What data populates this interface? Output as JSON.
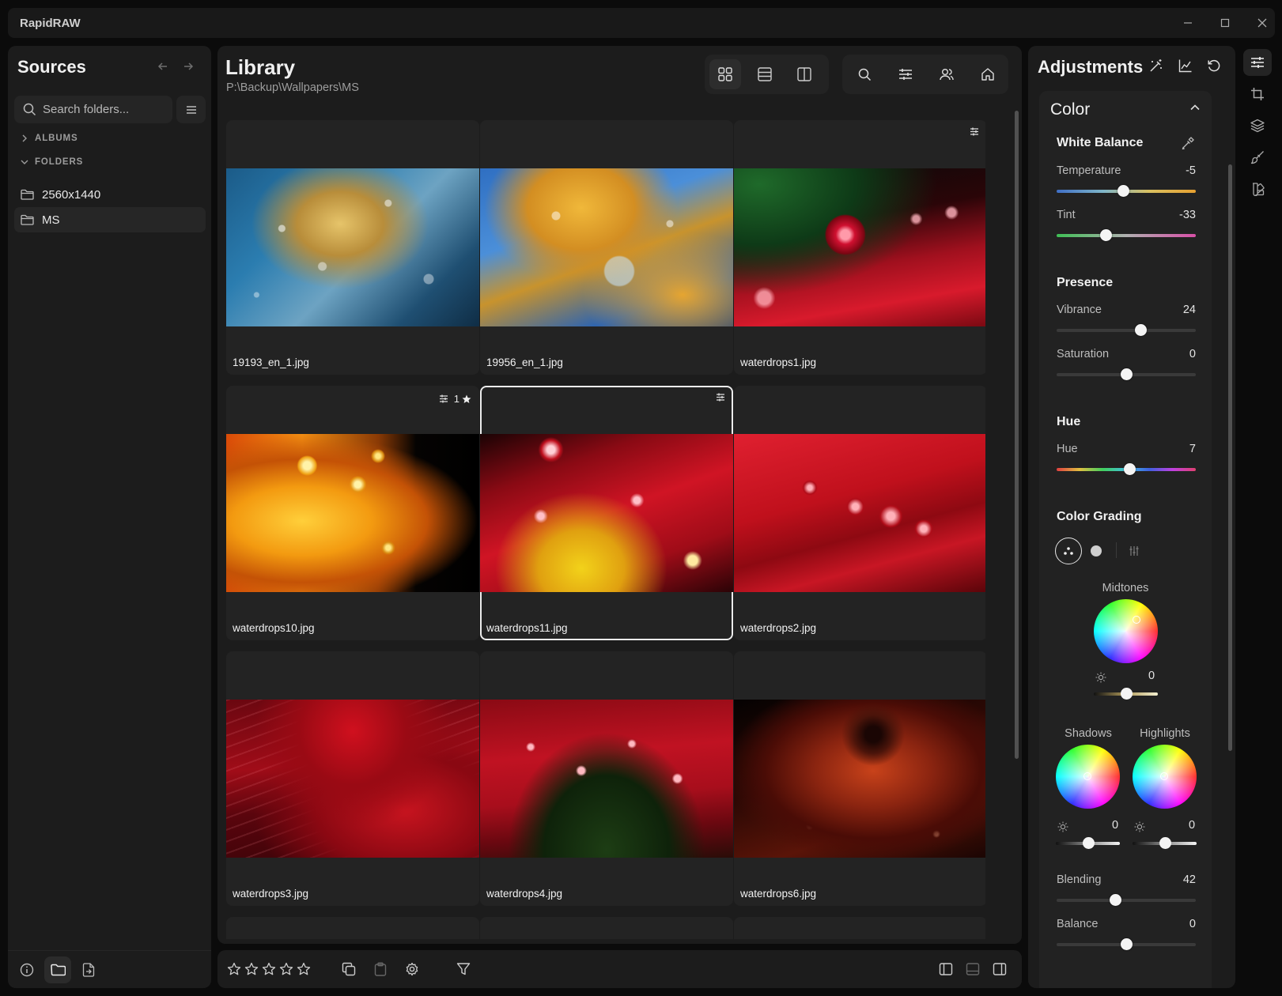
{
  "app": {
    "title": "RapidRAW"
  },
  "sources": {
    "title": "Sources",
    "search_placeholder": "Search folders...",
    "albums_label": "ALBUMS",
    "folders_label": "FOLDERS",
    "folders": [
      {
        "name": "2560x1440",
        "active": false
      },
      {
        "name": "MS",
        "active": true
      }
    ]
  },
  "library": {
    "title": "Library",
    "path": "P:\\Backup\\Wallpapers\\MS",
    "images": [
      {
        "name": "19193_en_1.jpg",
        "selected": false,
        "edited": false,
        "rating": null
      },
      {
        "name": "19956_en_1.jpg",
        "selected": false,
        "edited": false,
        "rating": null
      },
      {
        "name": "waterdrops1.jpg",
        "selected": false,
        "edited": true,
        "rating": null
      },
      {
        "name": "waterdrops10.jpg",
        "selected": false,
        "edited": true,
        "rating": "1"
      },
      {
        "name": "waterdrops11.jpg",
        "selected": true,
        "edited": true,
        "rating": null
      },
      {
        "name": "waterdrops2.jpg",
        "selected": false,
        "edited": false,
        "rating": null
      },
      {
        "name": "waterdrops3.jpg",
        "selected": false,
        "edited": false,
        "rating": null
      },
      {
        "name": "waterdrops4.jpg",
        "selected": false,
        "edited": false,
        "rating": null
      },
      {
        "name": "waterdrops6.jpg",
        "selected": false,
        "edited": false,
        "rating": null
      }
    ]
  },
  "adjustments": {
    "title": "Adjustments",
    "section": "Color",
    "white_balance": {
      "title": "White Balance",
      "temperature": {
        "label": "Temperature",
        "value": "-5",
        "fraction": 0.475
      },
      "tint": {
        "label": "Tint",
        "value": "-33",
        "fraction": 0.35
      }
    },
    "presence": {
      "title": "Presence",
      "vibrance": {
        "label": "Vibrance",
        "value": "24",
        "fraction": 0.605
      },
      "saturation": {
        "label": "Saturation",
        "value": "0",
        "fraction": 0.5
      }
    },
    "hue": {
      "title": "Hue",
      "hue": {
        "label": "Hue",
        "value": "7",
        "fraction": 0.52
      }
    },
    "color_grading": {
      "title": "Color Grading",
      "midtones": {
        "label": "Midtones",
        "luminance": "0"
      },
      "shadows": {
        "label": "Shadows",
        "luminance": "0"
      },
      "highlights": {
        "label": "Highlights",
        "luminance": "0"
      },
      "blending": {
        "label": "Blending",
        "value": "42",
        "fraction": 0.42
      },
      "balance": {
        "label": "Balance",
        "value": "0",
        "fraction": 0.5
      }
    }
  },
  "colors": {
    "background": "#0b0b0b",
    "panel": "#1c1c1c",
    "card": "#232323",
    "accent": "#f4f4f4"
  }
}
